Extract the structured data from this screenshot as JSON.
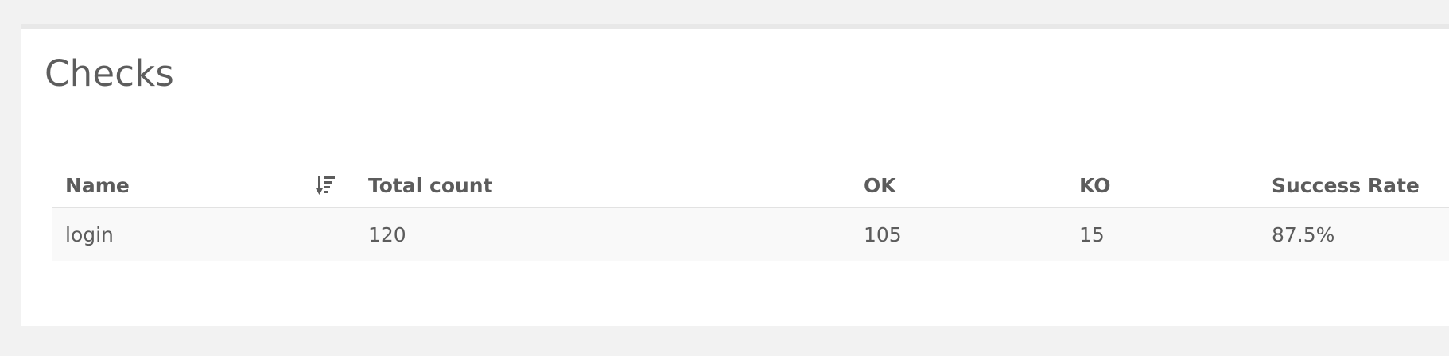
{
  "panel": {
    "title": "Checks"
  },
  "table": {
    "columns": [
      {
        "label": "Name",
        "sortable": true
      },
      {
        "label": "Total count"
      },
      {
        "label": "OK"
      },
      {
        "label": "KO"
      },
      {
        "label": "Success Rate"
      }
    ],
    "rows": [
      {
        "name": "login",
        "total_count": "120",
        "ok": "105",
        "ko": "15",
        "success_rate": "87.5%"
      }
    ]
  },
  "icons": {
    "sort": "sort-descending-icon"
  }
}
